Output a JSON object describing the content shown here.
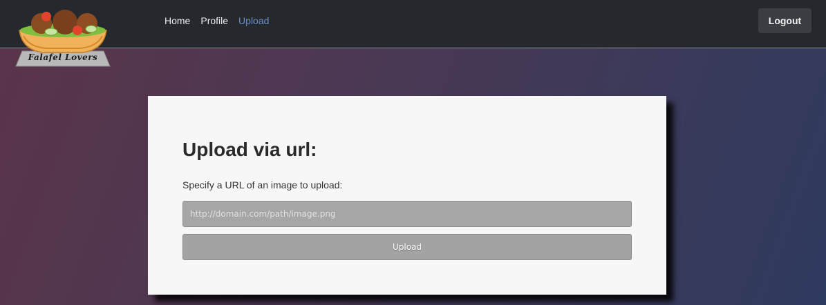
{
  "logo": {
    "text": "Falafel Lovers",
    "icon": "falafel-bowl-logo"
  },
  "nav": {
    "items": [
      {
        "label": "Home",
        "active": false
      },
      {
        "label": "Profile",
        "active": false
      },
      {
        "label": "Upload",
        "active": true
      }
    ],
    "logout_label": "Logout"
  },
  "upload": {
    "title": "Upload via url:",
    "description": "Specify a URL of an image to upload:",
    "url_placeholder": "http://domain.com/path/image.png",
    "url_value": "",
    "button_label": "Upload"
  },
  "colors": {
    "navbar_bg": "#25292d",
    "active_link": "#6d8dc7",
    "card_bg": "#f7f7f7",
    "input_bg": "#a6a6a6"
  }
}
